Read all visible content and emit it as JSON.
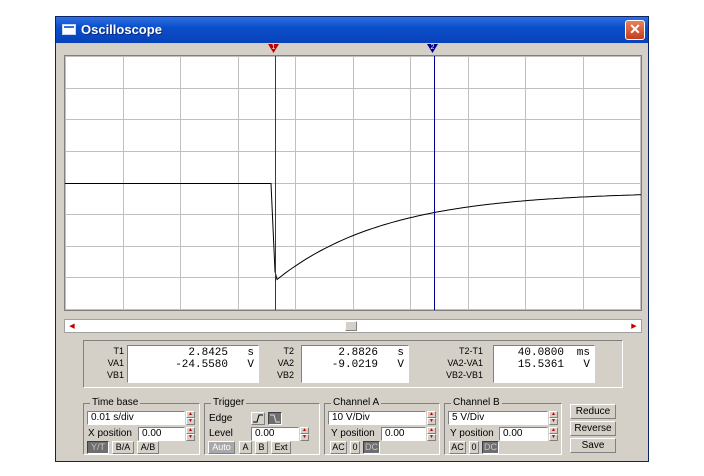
{
  "window": {
    "title": "Oscilloscope",
    "close_glyph": "✕"
  },
  "cursors": {
    "t1": {
      "label": "1",
      "color": "#c00000"
    },
    "t2": {
      "label": "2",
      "color": "#00008b"
    }
  },
  "readout": {
    "t1": {
      "T_label": "T1",
      "T_value": "2.8425",
      "T_unit": "s",
      "VA_label": "VA1",
      "VA_value": "-24.5580",
      "VA_unit": "V",
      "VB_label": "VB1"
    },
    "t2": {
      "T_label": "T2",
      "T_value": "2.8826",
      "T_unit": "s",
      "VA_label": "VA2",
      "VA_value": "-9.0219",
      "VA_unit": "V",
      "VB_label": "VB2"
    },
    "diff": {
      "T_label": "T2-T1",
      "T_value": "40.0800",
      "T_unit": "ms",
      "VA_label": "VA2-VA1",
      "VA_value": "15.5361",
      "VA_unit": "V",
      "VB_label": "VB2-VB1"
    }
  },
  "timebase": {
    "title": "Time base",
    "scale": "0.01 s/div",
    "xpos_label": "X position",
    "xpos_value": "0.00",
    "mode_yt": "Y/T",
    "mode_ba": "B/A",
    "mode_ab": "A/B"
  },
  "trigger": {
    "title": "Trigger",
    "edge_label": "Edge",
    "level_label": "Level",
    "level_value": "0.00",
    "auto": "Auto",
    "a": "A",
    "b": "B",
    "ext": "Ext"
  },
  "channel_a": {
    "title": "Channel A",
    "scale": "10 V/Div",
    "ypos_label": "Y position",
    "ypos_value": "0.00",
    "ac": "AC",
    "zero": "0",
    "dc": "DC"
  },
  "channel_b": {
    "title": "Channel B",
    "scale": "5 V/Div",
    "ypos_label": "Y position",
    "ypos_value": "0.00",
    "ac": "AC",
    "zero": "0",
    "dc": "DC"
  },
  "actions": {
    "reduce": "Reduce",
    "reverse": "Reverse",
    "save": "Save"
  },
  "colors": {
    "trace": "#000000",
    "grid": "#c0c0c0",
    "cursor1": "#c00000",
    "cursor2": "#00008b"
  }
}
